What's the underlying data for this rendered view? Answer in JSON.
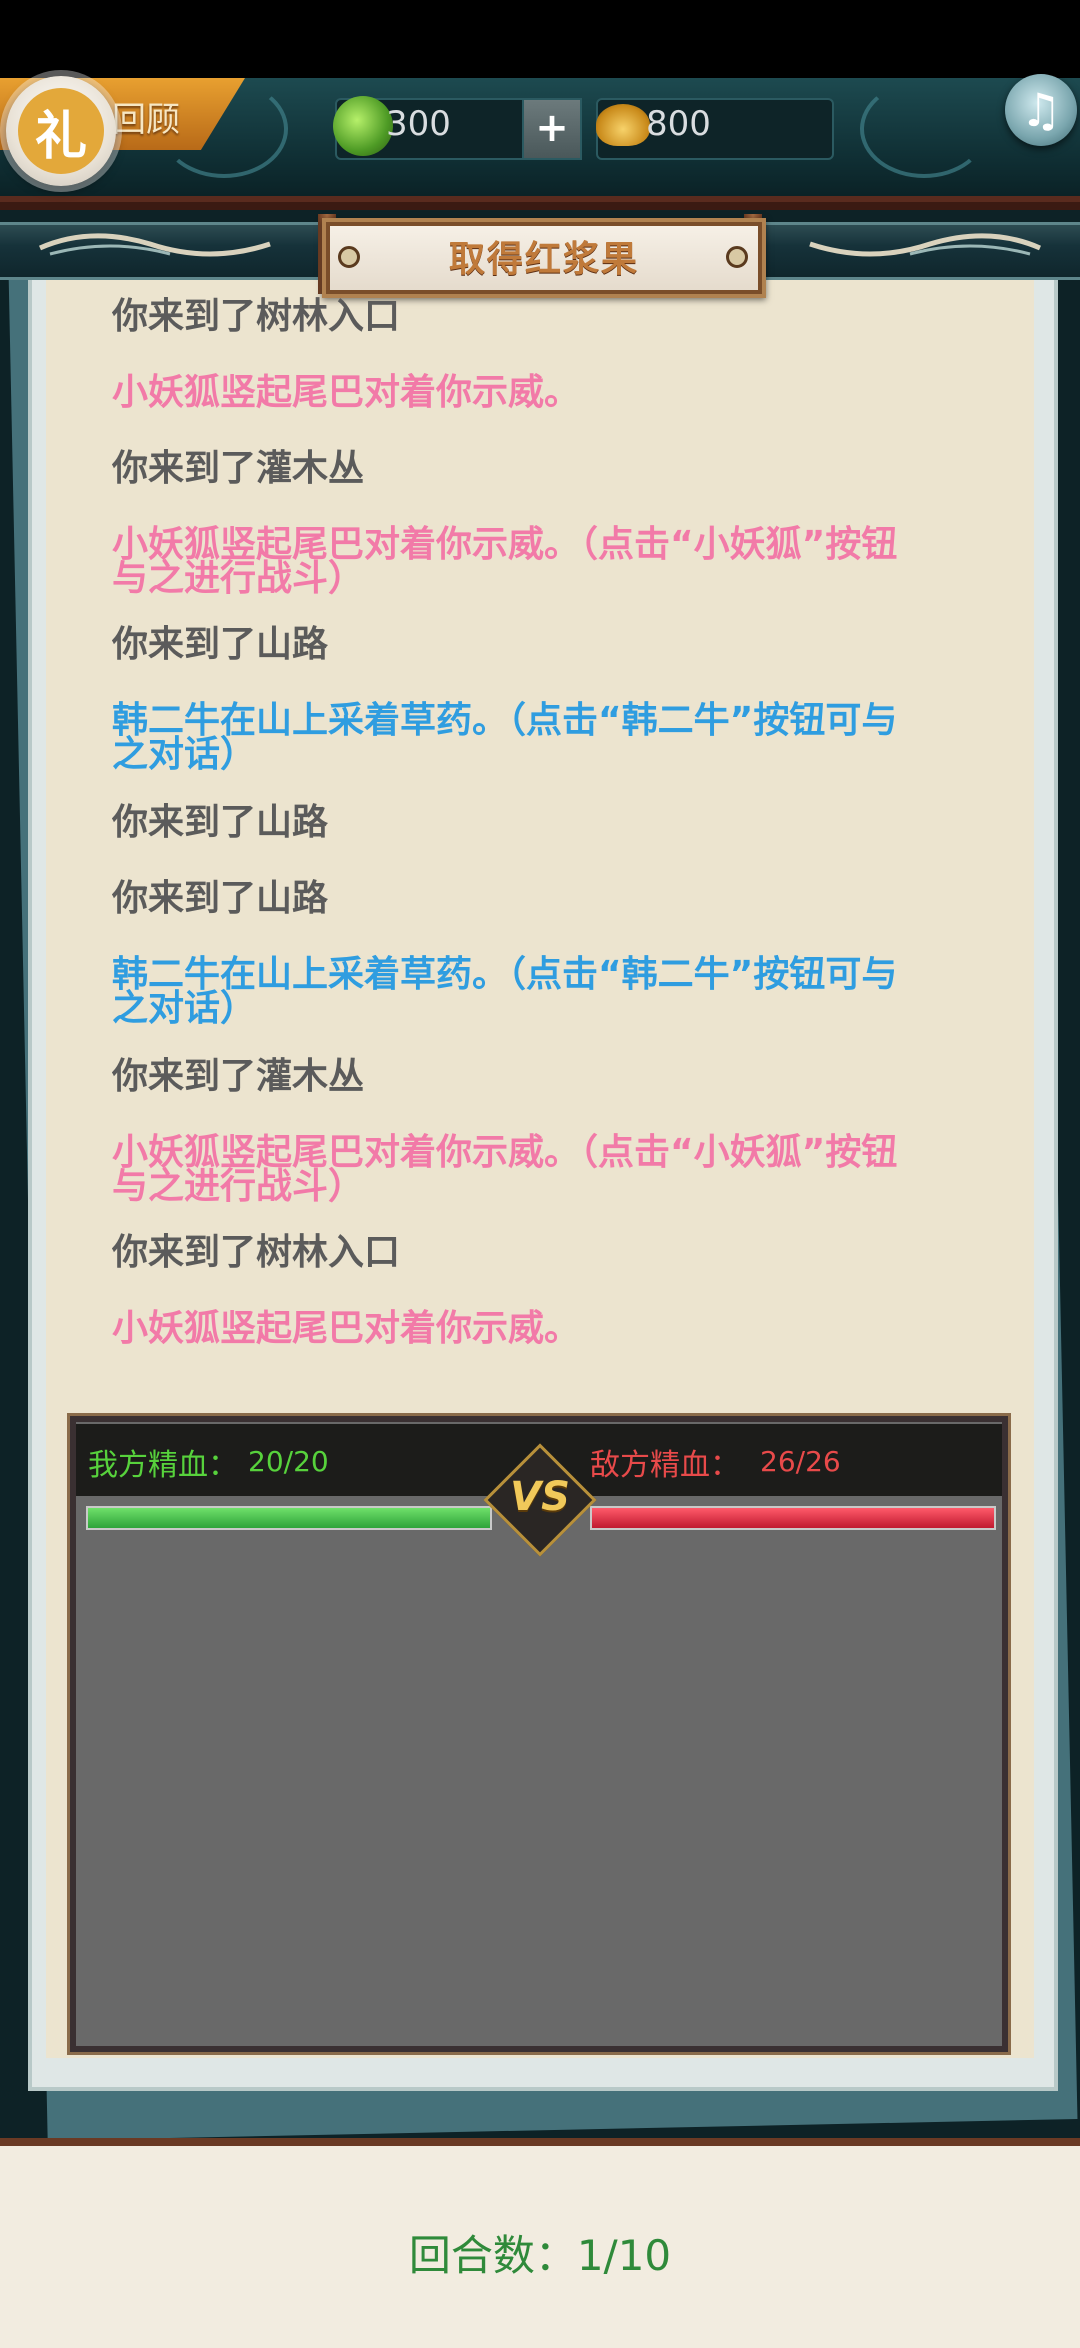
{
  "header": {
    "review_label": "回顾",
    "gift_label": "礼",
    "jade_amount": "300",
    "plus_label": "+",
    "gold_amount": "800",
    "music_icon": "music-note-icon"
  },
  "panel": {
    "title": "取得红浆果"
  },
  "log": {
    "lines": [
      {
        "text": "你来到了树林入口",
        "color": "gray"
      },
      {
        "text": "小妖狐竖起尾巴对着你示威。",
        "color": "pink"
      },
      {
        "text": "你来到了灌木丛",
        "color": "gray"
      },
      {
        "text": "小妖狐竖起尾巴对着你示威。（点击“小妖狐”按钮",
        "color": "pink"
      },
      {
        "text": "与之进行战斗）",
        "color": "pink"
      },
      {
        "text": "你来到了山路",
        "color": "gray"
      },
      {
        "text": "韩二牛在山上采着草药。（点击“韩二牛”按钮可与",
        "color": "blue"
      },
      {
        "text": "之对话）",
        "color": "blue"
      },
      {
        "text": "你来到了山路",
        "color": "gray"
      },
      {
        "text": "你来到了山路",
        "color": "gray"
      },
      {
        "text": "韩二牛在山上采着草药。（点击“韩二牛”按钮可与",
        "color": "blue"
      },
      {
        "text": "之对话）",
        "color": "blue"
      },
      {
        "text": "你来到了灌木丛",
        "color": "gray"
      },
      {
        "text": "小妖狐竖起尾巴对着你示威。（点击“小妖狐”按钮",
        "color": "pink"
      },
      {
        "text": "与之进行战斗）",
        "color": "pink"
      },
      {
        "text": "你来到了树林入口",
        "color": "gray"
      },
      {
        "text": "小妖狐竖起尾巴对着你示威。",
        "color": "pink"
      }
    ]
  },
  "battle": {
    "our_label": "我方精血：",
    "our_value": "20/20",
    "our_fraction": 1.0,
    "enemy_label": "敌方精血：",
    "enemy_value": "26/26",
    "enemy_fraction": 1.0,
    "vs_label": "VS"
  },
  "footer": {
    "round_text": "回合数：1/10"
  },
  "colors": {
    "gray": "#5b5b5b",
    "pink": "#f27aa8",
    "blue": "#2f9de0",
    "hp_ours": "#2ea33a",
    "hp_enemy": "#c01a30"
  }
}
